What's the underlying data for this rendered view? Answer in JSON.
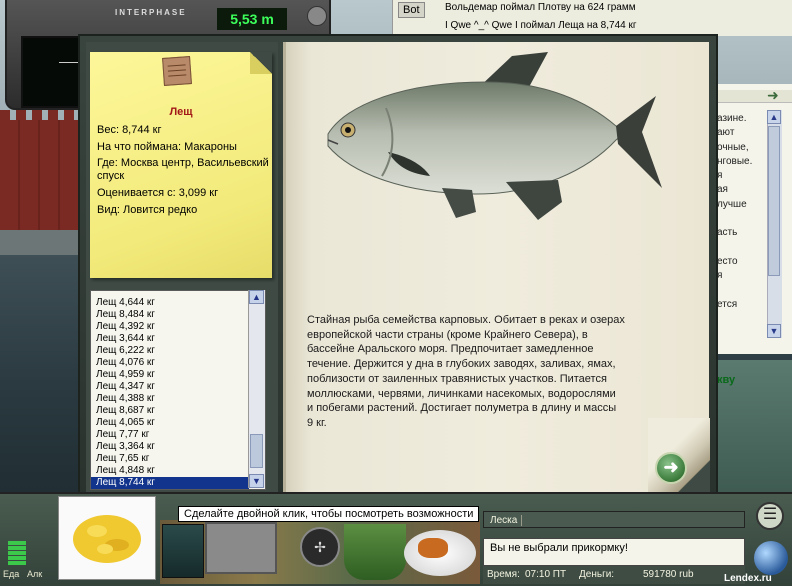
{
  "device": {
    "brand": "INTERPHASE",
    "depth": "5,53 m"
  },
  "chat": {
    "tab": "Bot",
    "lines": [
      "Вольдемар поймал Плотву на 624 грамм",
      "I Qwe ^_^ Qwe I поймал Леща на 8,744 кг"
    ]
  },
  "help_panel": {
    "fragments": [
      "азине.",
      "ают",
      "очные,",
      "нговые.",
      "я",
      "ая",
      "лучше",
      "",
      "асть",
      "",
      "есто",
      "я",
      "",
      "ется"
    ],
    "bold_fragment": "кву"
  },
  "catch_card": {
    "title": "Лещ",
    "weight": "Вес: 8,744 кг",
    "bait": "На что поймана: Макароны",
    "location": "Где: Москва центр, Васильевский спуск",
    "value": "Оценивается с: 3,099 кг",
    "kind": "Вид: Ловится редко"
  },
  "catch_list": {
    "items": [
      "Лещ 4,644 кг",
      "Лещ 8,484 кг",
      "Лещ 4,392 кг",
      "Лещ 3,644 кг",
      "Лещ 6,222 кг",
      "Лещ 4,076 кг",
      "Лещ 4,959 кг",
      "Лещ 4,347 кг",
      "Лещ 4,388 кг",
      "Лещ 8,687 кг",
      "Лещ 4,065 кг",
      "Лещ 7,77 кг",
      "Лещ 3,364 кг",
      "Лещ 7,65 кг",
      "Лещ 4,848 кг",
      "Лещ 8,744 кг"
    ],
    "selected_index": 15
  },
  "description": "Стайная рыба семейства карповых. Обитает в реках и озерах европейской части страны (кроме Крайнего Севера), в бассейне Аральского моря. Предпочитает замедленное течение. Держится у дна в глубоких заводях, заливах, ямах, поблизости от заиленных травянистых участков. Питается моллюсками, червями, личинками насекомых, водорослями и побегами растений. Достигает полуметра в длину и массы 9 кг.",
  "bottom": {
    "meter_label_food": "Еда",
    "meter_label_alcohol": "Алк",
    "tooltip": "Сделайте двойной клик, чтобы посмотреть возможности",
    "line_label": "Леска",
    "bait_message": "Вы не выбрали прикормку!",
    "time_label": "Время:",
    "time_value": "07:10 ПТ",
    "money_label": "Деньги:",
    "money_value": "591780 rub",
    "watermark": "Lendex.ru"
  },
  "colors": {
    "note": "#f4ec80",
    "selection": "#12348c",
    "title": "#a21818"
  }
}
